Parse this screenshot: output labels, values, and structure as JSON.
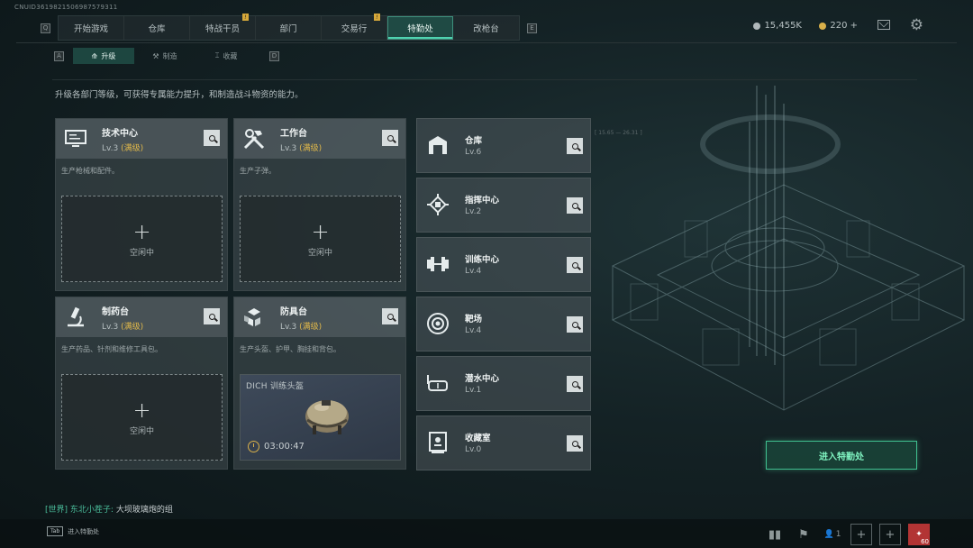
{
  "uid": "CNUID3619821506987579311",
  "topnav": {
    "left_key": "Q",
    "right_key": "E",
    "tabs": [
      {
        "label": "开始游戏",
        "alert": false
      },
      {
        "label": "仓库",
        "alert": false
      },
      {
        "label": "特战干员",
        "alert": true
      },
      {
        "label": "部门",
        "alert": false
      },
      {
        "label": "交易行",
        "alert": true
      },
      {
        "label": "特勤处",
        "alert": false,
        "active": true
      },
      {
        "label": "改枪台",
        "alert": false
      }
    ]
  },
  "currency": {
    "coins": "15,455K",
    "coins_color": "#b0b8ba",
    "premium": "220 +",
    "premium_color": "#d9b04a"
  },
  "subnav": {
    "left_key": "A",
    "right_key": "D",
    "tabs": [
      {
        "label": "升级",
        "icon": "upgrade-icon",
        "active": true
      },
      {
        "label": "制造",
        "icon": "craft-icon"
      },
      {
        "label": "收藏",
        "icon": "collection-icon"
      }
    ]
  },
  "description": "升级各部门等级，可获得专属能力提升，和制造战斗物资的能力。",
  "big_cards": [
    {
      "name": "技术中心",
      "level": "Lv.3",
      "max": "(满级)",
      "desc": "生产枪械和配件。",
      "icon": "computer-icon",
      "slot_plus": "+",
      "slot_status": "空闲中"
    },
    {
      "name": "工作台",
      "level": "Lv.3",
      "max": "(满级)",
      "desc": "生产子弹。",
      "icon": "tools-icon",
      "slot_plus": "+",
      "slot_status": "空闲中"
    },
    {
      "name": "制药台",
      "level": "Lv.3",
      "max": "(满级)",
      "desc": "生产药品、针剂和维修工具包。",
      "icon": "microscope-icon",
      "slot_plus": "+",
      "slot_status": "空闲中"
    },
    {
      "name": "防具台",
      "level": "Lv.3",
      "max": "(满级)",
      "desc": "生产头盔、护甲、胸挂和背包。",
      "icon": "armor-icon",
      "craft_item": "DICH 训练头盔",
      "craft_timer": "03:00:47"
    }
  ],
  "small_cards": [
    {
      "name": "仓库",
      "level": "Lv.6",
      "icon": "warehouse-icon"
    },
    {
      "name": "指挥中心",
      "level": "Lv.2",
      "icon": "chip-icon"
    },
    {
      "name": "训练中心",
      "level": "Lv.4",
      "icon": "dumbbell-icon"
    },
    {
      "name": "靶场",
      "level": "Lv.4",
      "icon": "target-icon"
    },
    {
      "name": "潜水中心",
      "level": "Lv.1",
      "icon": "diving-mask-icon"
    },
    {
      "name": "收藏室",
      "level": "Lv.0",
      "icon": "display-case-icon"
    }
  ],
  "enter_button": "进入特勤处",
  "chat": {
    "channel": "[世界]",
    "user": "东北小茬子:",
    "message": "大坝玻璃炮的组"
  },
  "bottom": {
    "tab_key": "Tab",
    "tab_label": "进入特勤处",
    "friends_count": "1",
    "badge_count": "60"
  }
}
